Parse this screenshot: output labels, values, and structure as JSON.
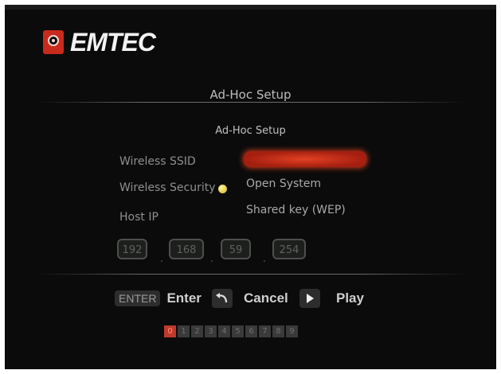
{
  "logo": {
    "text": "EMTEC"
  },
  "header": {
    "title": "Ad-Hoc Setup"
  },
  "panel": {
    "subtitle": "Ad-Hoc Setup",
    "ssid": {
      "label": "Wireless SSID",
      "value": ""
    },
    "security": {
      "label": "Wireless Security",
      "options": [
        "Open System",
        "Shared key (WEP)"
      ]
    },
    "host_ip": {
      "label": "Host IP",
      "octets": [
        "192",
        "168",
        "59",
        "254"
      ],
      "separator": "."
    }
  },
  "legend": {
    "enter_key": "ENTER",
    "enter_label": "Enter",
    "cancel_label": "Cancel",
    "play_label": "Play"
  },
  "pager": {
    "pages": [
      "0",
      "1",
      "2",
      "3",
      "4",
      "5",
      "6",
      "7",
      "8",
      "9"
    ],
    "active": "0"
  },
  "colors": {
    "accent": "#c0392b",
    "background": "#0b0b0b"
  }
}
